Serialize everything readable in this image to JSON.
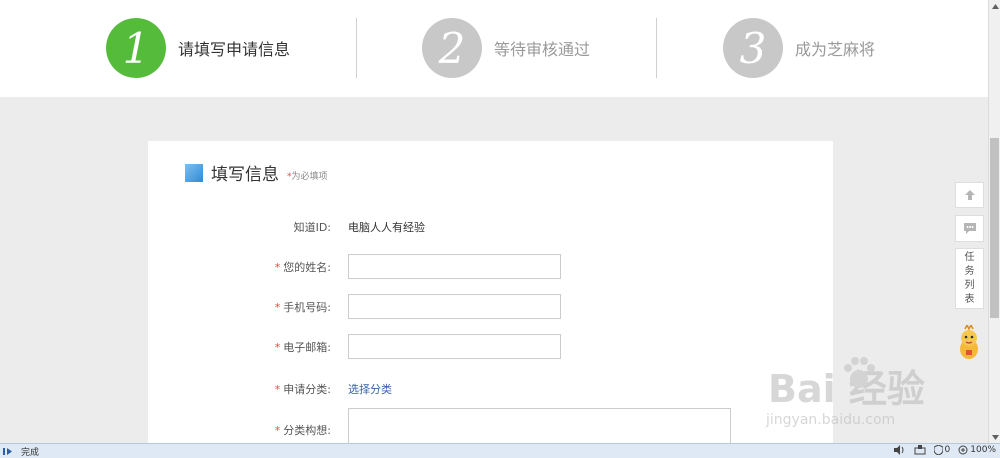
{
  "steps": [
    {
      "number": "1",
      "label": "请填写申请信息"
    },
    {
      "number": "2",
      "label": "等待审核通过"
    },
    {
      "number": "3",
      "label": "成为芝麻将"
    }
  ],
  "form": {
    "title": "填写信息",
    "required_star": "*",
    "required_note": "为必填项",
    "zhidao_id_label": "知道ID:",
    "zhidao_id_value": "电脑人人有经验",
    "name_label": "您的姓名:",
    "name_value": "",
    "phone_label": "手机号码:",
    "phone_value": "",
    "email_label": "电子邮箱:",
    "email_value": "",
    "category_label": "申请分类:",
    "category_link": "选择分类",
    "idea_label": "分类构想:",
    "idea_value": ""
  },
  "tools": {
    "task_list": [
      "任",
      "务",
      "列",
      "表"
    ]
  },
  "watermark": {
    "logo": "Bai  经验",
    "url": "jingyan.baidu.com"
  },
  "statusbar": {
    "status": "完成",
    "security_count": "0",
    "zoom": "100%"
  },
  "colors": {
    "active_step": "#55bb3b",
    "inactive_step": "#c8c8c8",
    "required_star": "#e64545",
    "link": "#3a63a8"
  }
}
